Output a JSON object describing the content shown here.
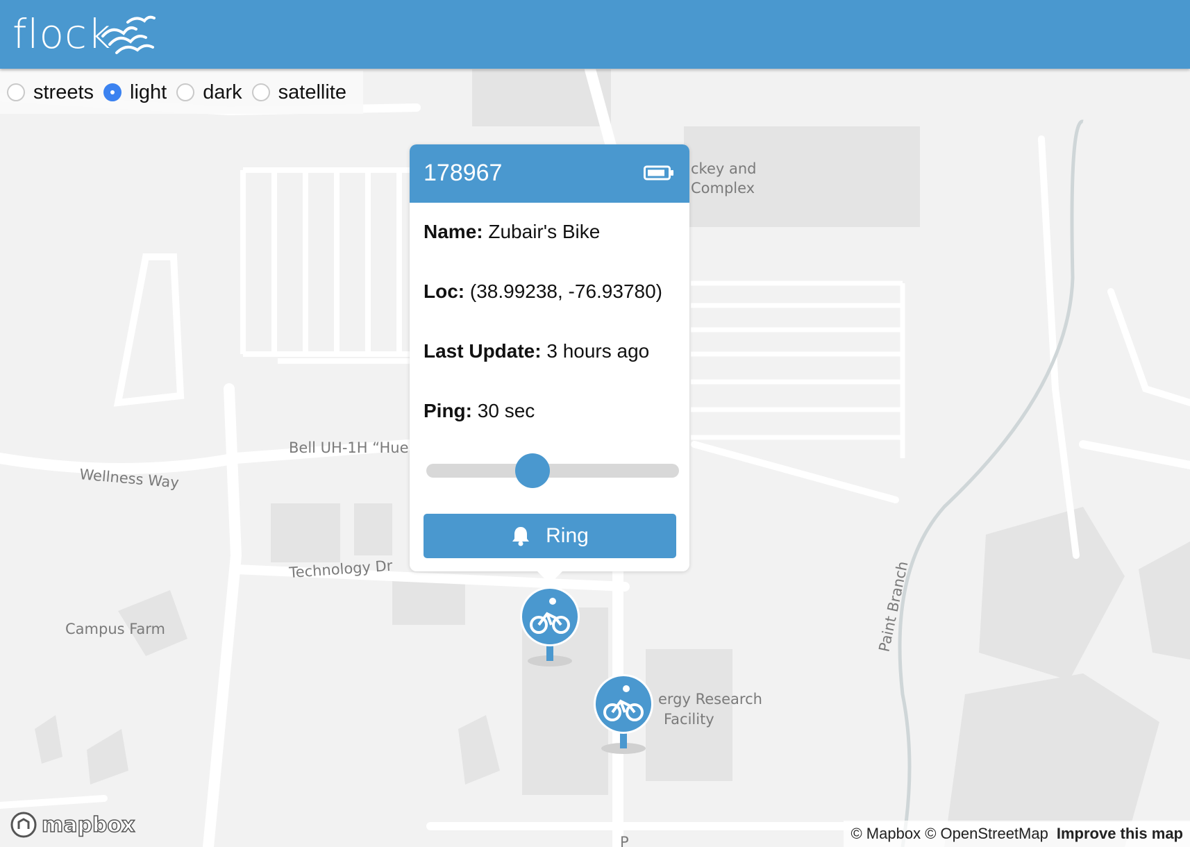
{
  "header": {
    "logo_text": "flock"
  },
  "map_styles": {
    "options": [
      {
        "label": "streets",
        "checked": false
      },
      {
        "label": "light",
        "checked": true
      },
      {
        "label": "dark",
        "checked": false
      },
      {
        "label": "satellite",
        "checked": false
      }
    ]
  },
  "map_labels": {
    "hockey_line1": "ckey and",
    "hockey_line2": "Complex",
    "bell": "Bell UH-1H “Hue",
    "wellness": "Wellness Way",
    "technology": "Technology Dr",
    "campus_farm": "Campus Farm",
    "energy_line1": "ergy Research",
    "energy_line2": "Facility",
    "paint_branch": "Paint Branch",
    "road_p": "P"
  },
  "popup": {
    "device_id": "178967",
    "name_label": "Name:",
    "name_value": "Zubair's Bike",
    "loc_label": "Loc:",
    "loc_value": "(38.99238, -76.93780)",
    "update_label": "Last Update:",
    "update_value": "3 hours ago",
    "ping_label": "Ping:",
    "ping_value": "30 sec",
    "ping_slider_fraction": 0.42,
    "ring_label": "Ring"
  },
  "attribution": {
    "mapbox": "© Mapbox",
    "osm": "© OpenStreetMap",
    "improve": "Improve this map",
    "logo_text": "mapbox"
  },
  "colors": {
    "brand": "#4a98cf",
    "radio_checked": "#3b82f0",
    "map_bg": "#f2f2f2"
  }
}
